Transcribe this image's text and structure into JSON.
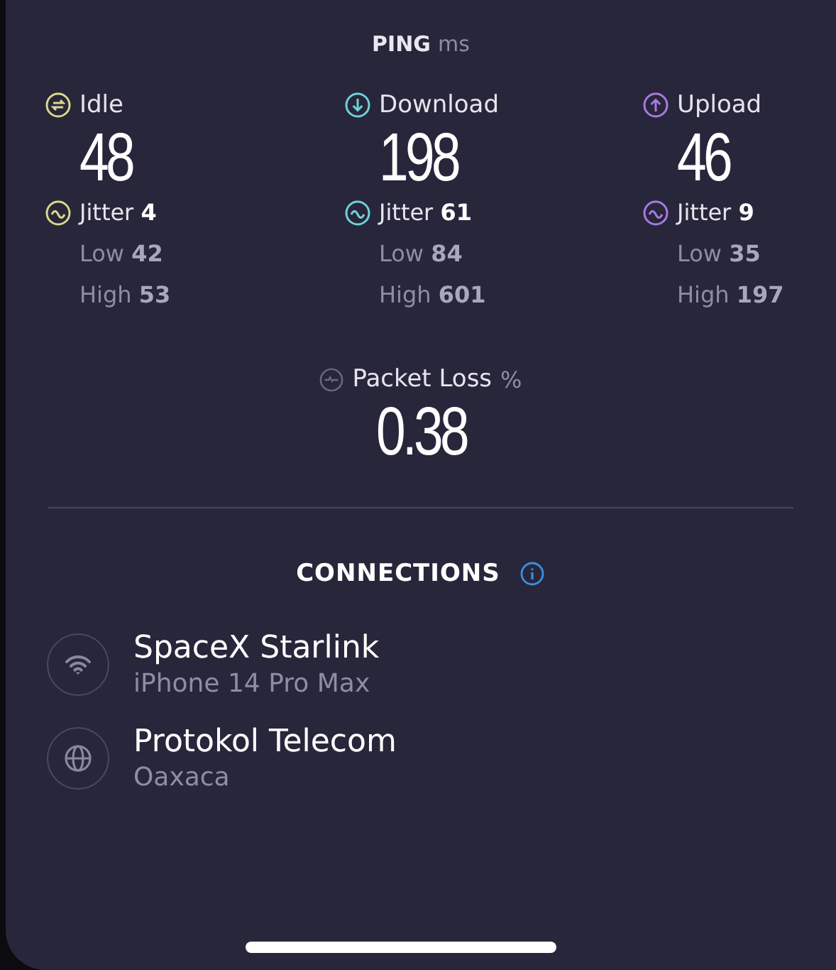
{
  "ping": {
    "title": "PING",
    "unit": "ms"
  },
  "metrics": [
    {
      "kind": "idle",
      "label": "Idle",
      "value": "48",
      "color": "#d9d88c",
      "jitter_label": "Jitter",
      "jitter": "4",
      "low_label": "Low",
      "low": "42",
      "high_label": "High",
      "high": "53"
    },
    {
      "kind": "download",
      "label": "Download",
      "value": "198",
      "color": "#6fd2da",
      "jitter_label": "Jitter",
      "jitter": "61",
      "low_label": "Low",
      "low": "84",
      "high_label": "High",
      "high": "601"
    },
    {
      "kind": "upload",
      "label": "Upload",
      "value": "46",
      "color": "#a77ae2",
      "jitter_label": "Jitter",
      "jitter": "9",
      "low_label": "Low",
      "low": "35",
      "high_label": "High",
      "high": "197"
    }
  ],
  "packet_loss": {
    "label": "Packet Loss",
    "unit": "%",
    "value": "0.38"
  },
  "connections": {
    "title": "CONNECTIONS",
    "items": [
      {
        "kind": "wifi",
        "name": "SpaceX Starlink",
        "detail": "iPhone 14 Pro Max"
      },
      {
        "kind": "globe",
        "name": "Protokol Telecom",
        "detail": "Oaxaca"
      }
    ]
  }
}
